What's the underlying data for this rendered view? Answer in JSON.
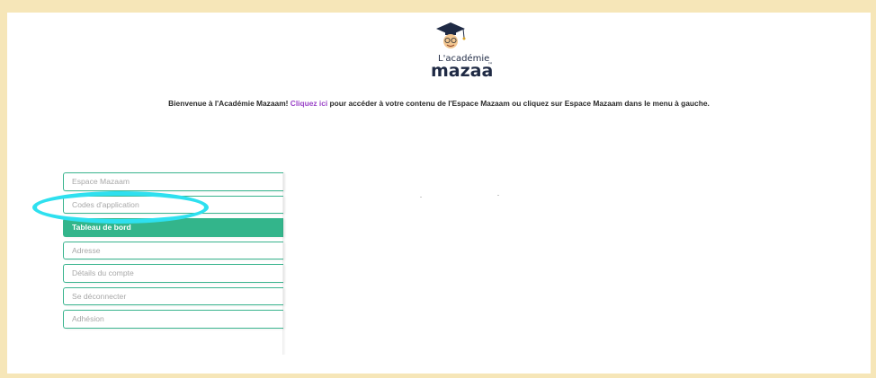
{
  "logo": {
    "line1": "L'académie",
    "line2": "mazaam",
    "trademark": "™"
  },
  "welcome": {
    "before": "Bienvenue à l'Académie Mazaam! ",
    "link": "Cliquez ici",
    "after": " pour accéder à votre contenu de l'Espace Mazaam ou cliquez sur Espace Mazaam dans le menu à gauche."
  },
  "nav": {
    "items": [
      {
        "label": "Espace Mazaam"
      },
      {
        "label": "Codes d'application"
      },
      {
        "label": "Tableau de bord"
      },
      {
        "label": "Adresse"
      },
      {
        "label": "Détails du compte"
      },
      {
        "label": "Se déconnecter"
      },
      {
        "label": "Adhésion"
      }
    ],
    "active_item": "Tableau de bord",
    "highlighted_item": "Codes d'application"
  },
  "colors": {
    "background": "#f6e6b8",
    "accent_green": "#33b58b",
    "link_purple": "#9b45c8",
    "highlight_cyan": "#2ee0ef"
  }
}
